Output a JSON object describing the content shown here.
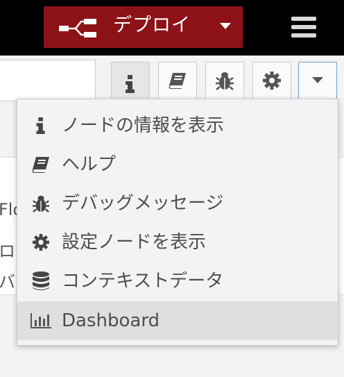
{
  "header": {
    "deploy": {
      "label": "デプロイ",
      "icon": "deploy-flow-icon",
      "bg_color": "#8c1218"
    },
    "menu_icon": "hamburger-icon"
  },
  "toolbar": {
    "buttons": [
      {
        "icon": "info-icon",
        "active": true
      },
      {
        "icon": "book-icon",
        "active": false
      },
      {
        "icon": "bug-icon",
        "active": false
      },
      {
        "icon": "gear-icon",
        "active": false
      },
      {
        "icon": "caret-down-icon",
        "active": false
      }
    ]
  },
  "background_fragments": [
    "Flo",
    "ロー",
    "バ"
  ],
  "dropdown_menu": {
    "items": [
      {
        "label": "ノードの情報を表示",
        "icon": "info-icon"
      },
      {
        "label": "ヘルプ",
        "icon": "book-icon"
      },
      {
        "label": "デバッグメッセージ",
        "icon": "bug-icon"
      },
      {
        "label": "設定ノードを表示",
        "icon": "gear-icon"
      },
      {
        "label": "コンテキストデータ",
        "icon": "database-icon"
      },
      {
        "label": "Dashboard",
        "icon": "bar-chart-icon",
        "highlighted": true
      }
    ]
  }
}
